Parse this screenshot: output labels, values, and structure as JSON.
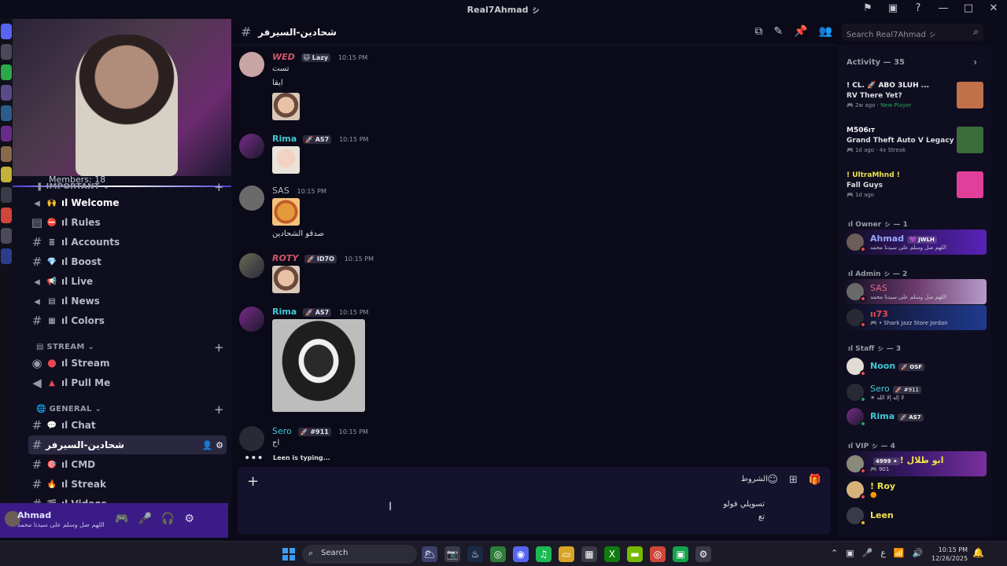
{
  "window": {
    "title": "Real7Ahmad ㇱ",
    "controls": [
      "⚑",
      "▣",
      "?",
      "—",
      "□",
      "✕"
    ]
  },
  "server_sidebar": {
    "members_text": "Members: 18",
    "categories": [
      {
        "name": "IMPORTANT",
        "emoji": "❚",
        "channels": [
          {
            "emoji": "🙌",
            "name": "ıl Welcome",
            "icon": "◂"
          },
          {
            "emoji": "⛔",
            "name": "ıl Rules",
            "icon": "▤"
          },
          {
            "emoji": "≣",
            "name": "ıl Accounts",
            "icon": "#"
          },
          {
            "emoji": "💎",
            "name": "ıl Boost",
            "icon": "#"
          },
          {
            "emoji": "📢",
            "name": "ıl Live",
            "icon": "◂"
          },
          {
            "emoji": "▤",
            "name": "ıl News",
            "icon": "◂"
          },
          {
            "emoji": "▦",
            "name": "ıl Colors",
            "icon": "#"
          }
        ]
      },
      {
        "name": "STREAM",
        "emoji": "▤",
        "channels": [
          {
            "emoji": "⬤",
            "name": "ıl Stream",
            "icon": "◉"
          },
          {
            "emoji": "▲",
            "name": "ıl Pull Me",
            "icon": "◀"
          }
        ]
      },
      {
        "name": "GENERAL",
        "emoji": "🌐",
        "channels": [
          {
            "emoji": "💬",
            "name": "ıl Chat",
            "icon": "#"
          },
          {
            "emoji": "",
            "name": "شحادين-السيرفر",
            "icon": "#"
          },
          {
            "emoji": "🎯",
            "name": "ıl CMD",
            "icon": "#"
          },
          {
            "emoji": "🔥",
            "name": "ıl Streak",
            "icon": "#"
          },
          {
            "emoji": "🎬",
            "name": "ıl Videos",
            "icon": "#"
          }
        ]
      }
    ]
  },
  "user_panel": {
    "name": "Ahmad",
    "status": "اللهم صل وسلم على سيدنا محمد",
    "icons": [
      "🎮",
      "🎤",
      "🎧",
      "⚙"
    ]
  },
  "channel_header": {
    "name": "شحادين-السيرفر",
    "icons": [
      "⧉",
      "✎",
      "📌",
      "👥"
    ],
    "search_placeholder": "Search Real7Ahmad ㇱ"
  },
  "messages": [
    {
      "author": "WED",
      "tag": "🐱 Lazy",
      "time": "10:15 PM",
      "color": "#d0566a",
      "lines": [
        "تست",
        "ايقا"
      ]
    },
    {
      "author": "Rima",
      "tag": "🚀 AS7",
      "time": "10:15 PM",
      "color": "#3ec9d6",
      "lines": []
    },
    {
      "author": "SAS",
      "tag": "",
      "time": "10:15 PM",
      "color": "#b5bac1",
      "lines": [
        "صدقو الشحادين"
      ]
    },
    {
      "author": "ROTY",
      "tag": "🚀 ID7O",
      "time": "10:15 PM",
      "color": "#d0566a",
      "lines": []
    },
    {
      "author": "Rima",
      "tag": "🚀 AS7",
      "time": "10:15 PM",
      "color": "#3ec9d6",
      "lines": []
    },
    {
      "author": "Sero",
      "tag": "🚀 #911",
      "time": "10:15 PM",
      "color": "#3ec9d6",
      "lines": [
        "اح"
      ]
    }
  ],
  "typing": "Leen is typing...",
  "composer": {
    "rules_label": "الشروط",
    "draft_line1": "تسويلي فولو",
    "draft_line2": "تع",
    "icons": [
      "☺",
      "⊞",
      "🎁"
    ]
  },
  "members_panel": {
    "activity_title": "Activity — 35",
    "activities": [
      {
        "who": "! CL. 🚀 ABO 3LUH ...",
        "game": "RV There Yet?",
        "ago": "2w ago",
        "extra": "New Player",
        "thumb": "#c0714a"
      },
      {
        "who": "M506ıт",
        "game": "Grand Theft Auto V Legacy",
        "ago": "1d ago",
        "extra": "4x Streak",
        "thumb": "#3a6b3a"
      },
      {
        "who": "! UltraMhnd !",
        "game": "Fall Guys",
        "ago": "1d ago",
        "extra": "",
        "thumb": "#e23f9a"
      }
    ],
    "groups": [
      {
        "title": "ıl Owner ㇱ — 1",
        "members": [
          {
            "name": "Ahmad",
            "tag": "💜 JWLH",
            "status": "اللهم صل وسلم على سيدنا محمد",
            "color": "#9aa6ff",
            "bg": "linear-gradient(90deg,#0f0e20,#5a22b8)",
            "dot": "#e8494f"
          }
        ]
      },
      {
        "title": "ıl Admin ㇱ — 2",
        "members": [
          {
            "name": "SAS",
            "tag": "",
            "status": "اللهم صل وسلم على سيدنا محمد",
            "color": "#e06a8a",
            "bg": "linear-gradient(90deg,#0f0e20,#6b3a6b,#b59bc9)",
            "dot": "#e8494f"
          },
          {
            "name": "ıı73",
            "tag": "",
            "status": "🎮 • Shark Jazz Store Jordan",
            "color": "#e8494f",
            "bg": "linear-gradient(90deg,#0f0e20,#1f3a8f)",
            "dot": "#e8494f"
          }
        ]
      },
      {
        "title": "ıl Staff ㇱ — 3",
        "members": [
          {
            "name": "Noon",
            "tag": "🚀 OSF",
            "status": "",
            "color": "#3ec9d6",
            "bg": "transparent",
            "dot": "#e8494f"
          },
          {
            "name": "Sero",
            "tag": "🚀 #911",
            "status": "☀ لا إله إلا الله",
            "color": "#3ec9d6",
            "bg": "transparent",
            "dot": "#23a55a"
          },
          {
            "name": "Rima",
            "tag": "🚀 AS7",
            "status": "",
            "color": "#3ec9d6",
            "bg": "transparent",
            "dot": "#23a55a"
          }
        ]
      },
      {
        "title": "ıl VIP ㇱ — 4",
        "members": [
          {
            "name": "ابو طلال !",
            "tag": "✦ 4999",
            "status": "🎮 901",
            "color": "#f0e14a",
            "bg": "linear-gradient(90deg,#0f0e20,#3a1a6b,#7a2fa0)",
            "dot": "#e8494f"
          },
          {
            "name": "! Roy",
            "tag": "",
            "status": "🟠",
            "color": "#f0e14a",
            "bg": "transparent",
            "dot": "#e8494f"
          },
          {
            "name": "Leen",
            "tag": "",
            "status": "",
            "color": "#f0e14a",
            "bg": "transparent",
            "dot": "#f0b232"
          }
        ]
      }
    ]
  },
  "taskbar": {
    "search": "Search",
    "apps": [
      {
        "glyph": "🌥",
        "color": "#3a3f6b"
      },
      {
        "glyph": "📷",
        "color": "#3a3a48"
      },
      {
        "glyph": "♨",
        "color": "#1b2a44"
      },
      {
        "glyph": "◎",
        "color": "#2f7d3a"
      },
      {
        "glyph": "◉",
        "color": "#5865f2"
      },
      {
        "glyph": "♫",
        "color": "#1db954"
      },
      {
        "glyph": "▭",
        "color": "#d8a326"
      },
      {
        "glyph": "▦",
        "color": "#3a3a48"
      },
      {
        "glyph": "X",
        "color": "#107c10"
      },
      {
        "glyph": "▬",
        "color": "#76b900"
      },
      {
        "glyph": "◎",
        "color": "#d0463a"
      },
      {
        "glyph": "▣",
        "color": "#13a34a"
      },
      {
        "glyph": "⚙",
        "color": "#3a3a48"
      }
    ],
    "tray": [
      "⌃",
      "▣",
      "🎤",
      "ع",
      "📶",
      "🔊"
    ],
    "time": "10:15 PM",
    "date": "12/26/2025"
  }
}
